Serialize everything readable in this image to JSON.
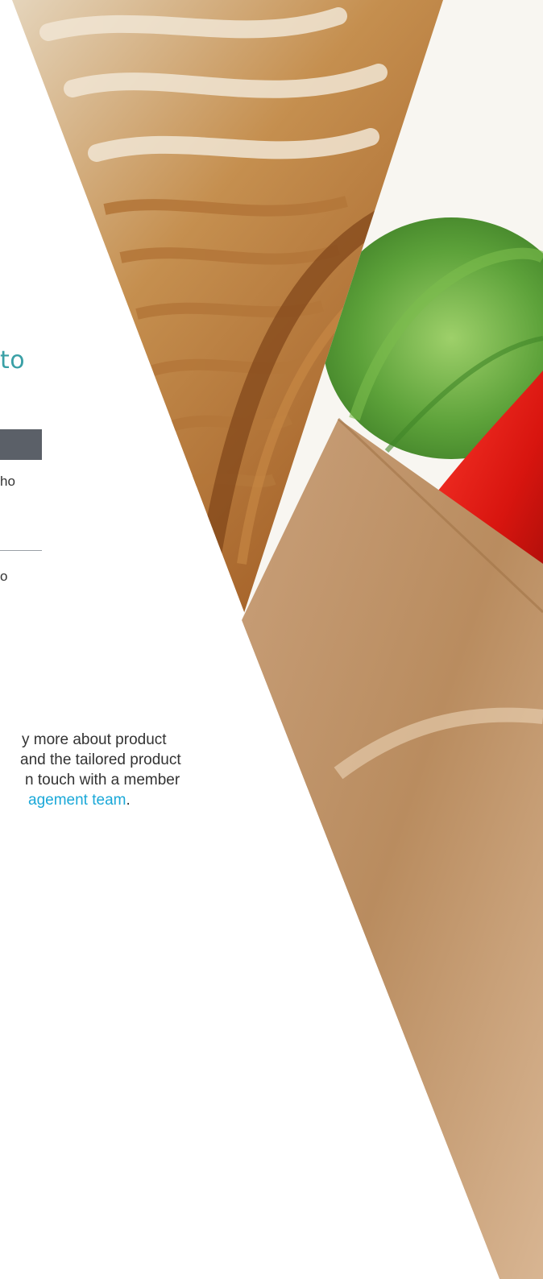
{
  "left_panel": {
    "heading_fragment": "to",
    "text_fragment_1": "ho",
    "text_fragment_2": "o",
    "paragraph": {
      "line1": "y more about product",
      "line2": "and the tailored product",
      "line3": "n touch with a member",
      "line4_link": "agement team",
      "line4_suffix": "."
    }
  },
  "colors": {
    "heading": "#3aa0a6",
    "dark_tab": "#5b6068",
    "link": "#1aa8d8"
  },
  "images": {
    "top_wedge": "wicker-basket-photo",
    "bottom_wedge": "vegetables-in-paper-bag-photo"
  }
}
